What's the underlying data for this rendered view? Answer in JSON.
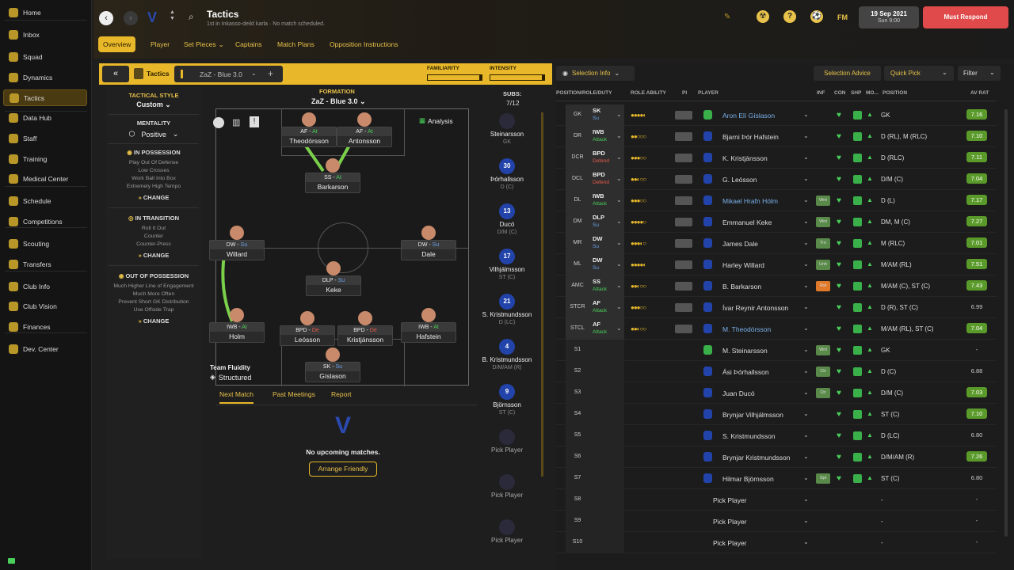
{
  "sidebar": {
    "items": [
      {
        "label": "Home",
        "icon": "home-icon"
      },
      {
        "label": "Inbox",
        "icon": "inbox-icon"
      },
      {
        "label": "Squad",
        "icon": "shirt-icon"
      },
      {
        "label": "Dynamics",
        "icon": "dynamics-icon"
      },
      {
        "label": "Tactics",
        "icon": "tactics-icon",
        "active": true
      },
      {
        "label": "Data Hub",
        "icon": "data-hub-icon"
      },
      {
        "label": "Staff",
        "icon": "staff-icon"
      },
      {
        "label": "Training",
        "icon": "training-icon"
      },
      {
        "label": "Medical Center",
        "icon": "medical-icon"
      },
      {
        "label": "Schedule",
        "icon": "calendar-icon"
      },
      {
        "label": "Competitions",
        "icon": "trophy-icon"
      },
      {
        "label": "Scouting",
        "icon": "binoculars-icon"
      },
      {
        "label": "Transfers",
        "icon": "transfer-icon"
      },
      {
        "label": "Club Info",
        "icon": "shield-icon"
      },
      {
        "label": "Club Vision",
        "icon": "vision-icon"
      },
      {
        "label": "Finances",
        "icon": "finance-icon"
      },
      {
        "label": "Dev. Center",
        "icon": "dev-center-icon"
      }
    ]
  },
  "header": {
    "title": "Tactics",
    "subtitle": "1st in Inkasso-deild karla · No match scheduled.",
    "date": "19 Sep 2021",
    "time": "Sun 9:00",
    "fm": "FM",
    "must_respond": "Must Respond",
    "tabs": [
      "Overview",
      "Player",
      "Set Pieces",
      "Captains",
      "Match Plans",
      "Opposition Instructions"
    ]
  },
  "tacticbar": {
    "tactics_label": "Tactics",
    "tactic_name": "ZaZ - Blue 3.0",
    "familiarity": "FAMILIARITY",
    "intensity": "INTENSITY",
    "familiarity_level": 0.95,
    "intensity_level": 0.95
  },
  "style": {
    "tactical_style": "TACTICAL STYLE",
    "custom": "Custom",
    "mentality_label": "MENTALITY",
    "mentality": "Positive",
    "in_possession": "IN POSSESSION",
    "in_possession_items": [
      "Play Out Of Defense",
      "Low Crosses",
      "Work Ball Into Box",
      "Extremely High Tempo"
    ],
    "change": "CHANGE",
    "in_transition": "IN TRANSITION",
    "in_transition_items": [
      "Roll It Out",
      "Counter",
      "Counter-Press"
    ],
    "out_of_possession": "OUT OF POSSESSION",
    "out_of_possession_items": [
      "Much Higher Line of Engagement",
      "Much More Often",
      "Prevent Short GK Distribution",
      "Use Offside Trap"
    ]
  },
  "formation": {
    "label": "FORMATION",
    "name": "ZaZ - Blue 3.0",
    "analysis": "Analysis",
    "team_fluidity": "Team Fluidity",
    "fluidity_value": "Structured",
    "players": [
      {
        "role": "AF",
        "duty": "At",
        "name": "Theodórsson"
      },
      {
        "role": "AF",
        "duty": "At",
        "name": "Antonsson"
      },
      {
        "role": "SS",
        "duty": "At",
        "name": "Barkarson"
      },
      {
        "role": "DW",
        "duty": "Su",
        "name": "Willard"
      },
      {
        "role": "DW",
        "duty": "Su",
        "name": "Dale"
      },
      {
        "role": "DLP",
        "duty": "Su",
        "name": "Keke"
      },
      {
        "role": "IWB",
        "duty": "At",
        "name": "Holm"
      },
      {
        "role": "BPD",
        "duty": "De",
        "name": "Leósson"
      },
      {
        "role": "BPD",
        "duty": "De",
        "name": "Kristjánsson"
      },
      {
        "role": "IWB",
        "duty": "At",
        "name": "Hafstein"
      },
      {
        "role": "SK",
        "duty": "Su",
        "name": "Gíslason"
      }
    ]
  },
  "subs": {
    "label": "SUBS:",
    "count": "7/12",
    "items": [
      {
        "num": "",
        "name": "Steinarsson",
        "pos": "GK"
      },
      {
        "num": "30",
        "name": "Þórhallsson",
        "pos": "D (C)"
      },
      {
        "num": "13",
        "name": "Ducó",
        "pos": "D/M (C)"
      },
      {
        "num": "17",
        "name": "Vilhjálmsson",
        "pos": "ST (C)"
      },
      {
        "num": "21",
        "name": "S. Kristmundsson",
        "pos": "D (LC)"
      },
      {
        "num": "4",
        "name": "B. Kristmundsson",
        "pos": "D/M/AM (R)"
      },
      {
        "num": "9",
        "name": "Björnsson",
        "pos": "ST (C)"
      },
      {
        "num": "",
        "name": "Pick Player",
        "pos": ""
      },
      {
        "num": "",
        "name": "Pick Player",
        "pos": ""
      },
      {
        "num": "",
        "name": "Pick Player",
        "pos": ""
      }
    ]
  },
  "bottom_tabs": [
    "Next Match",
    "Past Meetings",
    "Report"
  ],
  "next_match": {
    "no_matches": "No upcoming matches.",
    "arrange": "Arrange Friendly"
  },
  "right_panel": {
    "selection_info": "Selection Info",
    "selection_advice": "Selection Advice",
    "quick_pick": "Quick Pick",
    "filter": "Filter",
    "columns": [
      "POSITION/ROLE/DUTY",
      "ROLE ABILITY",
      "PI",
      "PLAYER",
      "INF",
      "CON",
      "SHP",
      "MO...",
      "POSITION",
      "AV RAT"
    ],
    "rows": [
      {
        "pos": "GK",
        "role": "SK",
        "duty": "Su",
        "stars": "●●●●◐",
        "player": "Aron Elí Gíslason",
        "hl": true,
        "inf": "",
        "position": "GK",
        "rating": "7.16"
      },
      {
        "pos": "DR",
        "role": "IWB",
        "duty": "Attack",
        "stars": "●●○○○",
        "player": "Bjarni Þór Hafstein",
        "hl": false,
        "inf": "",
        "position": "D (RL), M (RLC)",
        "rating": "7.10"
      },
      {
        "pos": "DCR",
        "role": "BPD",
        "duty": "Defend",
        "stars": "●●●○○",
        "player": "K. Kristjánsson",
        "hl": false,
        "inf": "",
        "position": "D (RLC)",
        "rating": "7.11"
      },
      {
        "pos": "DCL",
        "role": "BPD",
        "duty": "Defend",
        "stars": "●●◐○○",
        "player": "G. Leósson",
        "hl": false,
        "inf": "",
        "position": "D/M (C)",
        "rating": "7.04"
      },
      {
        "pos": "DL",
        "role": "IWB",
        "duty": "Attack",
        "stars": "●●●○○",
        "player": "Mikael Hrafn Hólm",
        "hl": true,
        "inf": "Wnt",
        "position": "D (L)",
        "rating": "7.17"
      },
      {
        "pos": "DM",
        "role": "DLP",
        "duty": "Su",
        "stars": "●●●●○",
        "player": "Emmanuel Keke",
        "hl": false,
        "inf": "Wnt",
        "position": "DM, M (C)",
        "rating": "7.27"
      },
      {
        "pos": "MR",
        "role": "DW",
        "duty": "Su",
        "stars": "●●●◐○",
        "player": "James Dale",
        "hl": false,
        "inf": "Trn",
        "position": "M (RLC)",
        "rating": "7.01"
      },
      {
        "pos": "ML",
        "role": "DW",
        "duty": "Su",
        "stars": "●●●●◐",
        "player": "Harley Willard",
        "hl": false,
        "inf": "Unh",
        "position": "M/AM (RL)",
        "rating": "7.51"
      },
      {
        "pos": "AMC",
        "role": "SS",
        "duty": "Attack",
        "stars": "●●◐○○",
        "player": "B. Barkarson",
        "hl": false,
        "inf": "Rst",
        "position": "M/AM (C), ST (C)",
        "rating": "7.43"
      },
      {
        "pos": "STCR",
        "role": "AF",
        "duty": "Attack",
        "stars": "●●●○○",
        "player": "Ívar Reynir Antonsson",
        "hl": false,
        "inf": "",
        "position": "D (R), ST (C)",
        "rating": "6.99"
      },
      {
        "pos": "STCL",
        "role": "AF",
        "duty": "Attack",
        "stars": "●●◐○○",
        "player": "M. Theodórsson",
        "hl": true,
        "inf": "",
        "position": "M/AM (RL), ST (C)",
        "rating": "7.04"
      },
      {
        "pos": "S1",
        "role": "",
        "duty": "",
        "stars": "",
        "player": "M. Steinarsson",
        "hl": false,
        "inf": "Wnt",
        "position": "GK",
        "rating": "-"
      },
      {
        "pos": "S2",
        "role": "",
        "duty": "",
        "stars": "",
        "player": "Ási Þórhallsson",
        "hl": false,
        "inf": "Ctr",
        "position": "D (C)",
        "rating": "6.88"
      },
      {
        "pos": "S3",
        "role": "",
        "duty": "",
        "stars": "",
        "player": "Juan Ducó",
        "hl": false,
        "inf": "Ctr",
        "position": "D/M (C)",
        "rating": "7.03"
      },
      {
        "pos": "S4",
        "role": "",
        "duty": "",
        "stars": "",
        "player": "Brynjar Vilhjálmsson",
        "hl": false,
        "inf": "",
        "position": "ST (C)",
        "rating": "7.10"
      },
      {
        "pos": "S5",
        "role": "",
        "duty": "",
        "stars": "",
        "player": "S. Kristmundsson",
        "hl": false,
        "inf": "",
        "position": "D (LC)",
        "rating": "6.80"
      },
      {
        "pos": "S6",
        "role": "",
        "duty": "",
        "stars": "",
        "player": "Brynjar Kristmundsson",
        "hl": false,
        "inf": "",
        "position": "D/M/AM (R)",
        "rating": "7.26"
      },
      {
        "pos": "S7",
        "role": "",
        "duty": "",
        "stars": "",
        "player": "Hilmar Björnsson",
        "hl": false,
        "inf": "Spt",
        "position": "ST (C)",
        "rating": "6.80"
      },
      {
        "pos": "S8",
        "role": "",
        "duty": "",
        "stars": "",
        "player": "Pick Player",
        "hl": false,
        "inf": "",
        "position": "-",
        "rating": "-"
      },
      {
        "pos": "S9",
        "role": "",
        "duty": "",
        "stars": "",
        "player": "Pick Player",
        "hl": false,
        "inf": "",
        "position": "-",
        "rating": "-"
      },
      {
        "pos": "S10",
        "role": "",
        "duty": "",
        "stars": "",
        "player": "Pick Player",
        "hl": false,
        "inf": "",
        "position": "-",
        "rating": "-"
      }
    ]
  },
  "colors": {
    "accent": "#e8b82a",
    "must_respond": "#e04a4a",
    "rating_green": "#5a9a2a"
  }
}
